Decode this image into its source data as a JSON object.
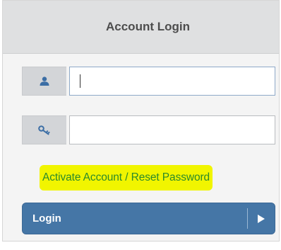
{
  "header": {
    "title": "Account Login"
  },
  "username": {
    "icon": "user-icon",
    "value": "",
    "placeholder": ""
  },
  "password": {
    "icon": "key-icon",
    "value": "",
    "placeholder": ""
  },
  "links": {
    "activate_reset": "Activate Account / Reset Password"
  },
  "login_button": {
    "label": "Login",
    "arrow_icon": "play-arrow-icon"
  },
  "colors": {
    "header_bg": "#dfe0e1",
    "button_bg": "#4576a6",
    "link_text": "#2b8a2b",
    "link_highlight": "#f1f500",
    "icon_color": "#3c6ea5"
  }
}
